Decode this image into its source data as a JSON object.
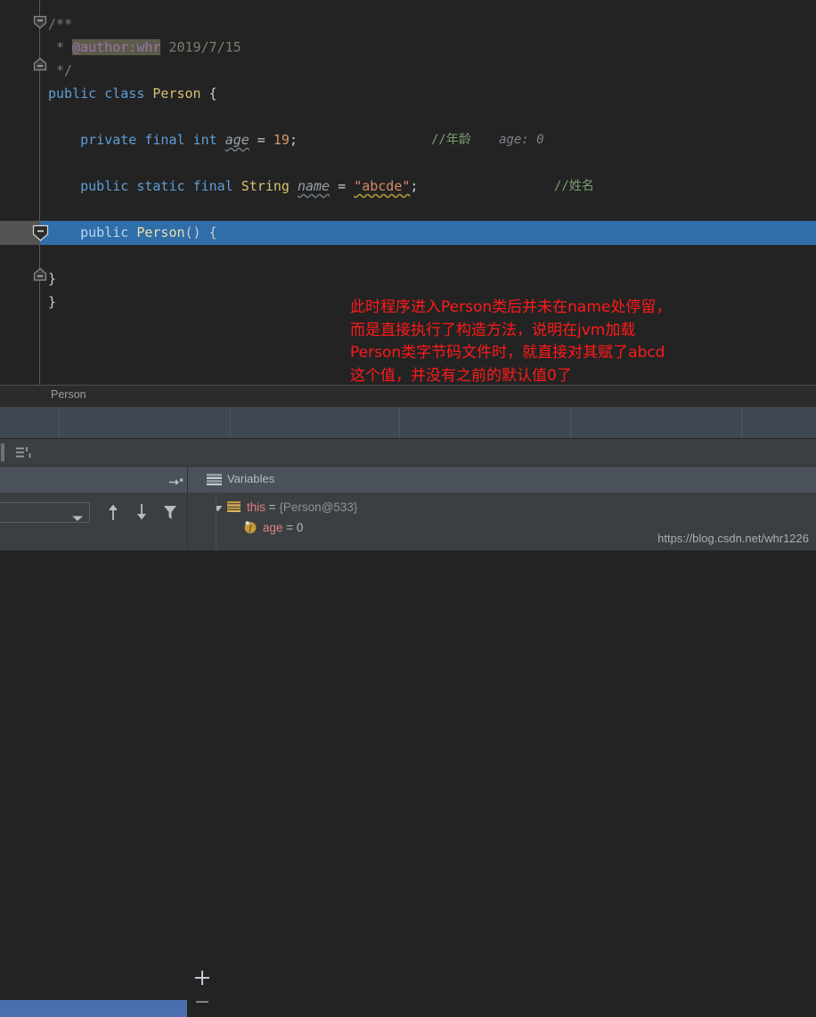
{
  "editor": {
    "lines": [
      {
        "indent": 0,
        "segments": [
          {
            "t": "/**",
            "c": "doc"
          }
        ]
      },
      {
        "indent": 0,
        "segments": [
          {
            "t": " * ",
            "c": "doc"
          },
          {
            "t": "@author:whr",
            "c": "doctag"
          },
          {
            "t": " 2019/7/15",
            "c": "doc"
          }
        ]
      },
      {
        "indent": 0,
        "segments": [
          {
            "t": " */",
            "c": "doc"
          }
        ]
      },
      {
        "indent": 0,
        "segments": [
          {
            "t": "public",
            "c": "kw"
          },
          {
            "t": " ",
            "c": "plain"
          },
          {
            "t": "class",
            "c": "kw"
          },
          {
            "t": " ",
            "c": "plain"
          },
          {
            "t": "Person",
            "c": "cls"
          },
          {
            "t": " {",
            "c": "plain"
          }
        ]
      },
      {
        "indent": 0,
        "segments": []
      },
      {
        "indent": 0,
        "segments": [
          {
            "t": "    ",
            "c": "plain"
          },
          {
            "t": "private",
            "c": "kw"
          },
          {
            "t": " ",
            "c": "plain"
          },
          {
            "t": "final",
            "c": "kw"
          },
          {
            "t": " ",
            "c": "plain"
          },
          {
            "t": "int",
            "c": "kw"
          },
          {
            "t": " ",
            "c": "plain"
          },
          {
            "t": "age",
            "c": "field-i wavy"
          },
          {
            "t": " = ",
            "c": "plain"
          },
          {
            "t": "19",
            "c": "num"
          },
          {
            "t": ";",
            "c": "plain"
          }
        ]
      },
      {
        "indent": 0,
        "segments": []
      },
      {
        "indent": 0,
        "segments": [
          {
            "t": "    ",
            "c": "plain"
          },
          {
            "t": "public",
            "c": "kw"
          },
          {
            "t": " ",
            "c": "plain"
          },
          {
            "t": "static",
            "c": "kw"
          },
          {
            "t": " ",
            "c": "plain"
          },
          {
            "t": "final",
            "c": "kw"
          },
          {
            "t": " ",
            "c": "plain"
          },
          {
            "t": "String",
            "c": "cls"
          },
          {
            "t": " ",
            "c": "plain"
          },
          {
            "t": "name",
            "c": "field-i wavy"
          },
          {
            "t": " = ",
            "c": "plain"
          },
          {
            "t": "\"abcde\"",
            "c": "str wavy-y"
          },
          {
            "t": ";",
            "c": "plain"
          }
        ]
      }
    ],
    "comment_age": "//年龄",
    "inline_hint_age": "age: 0",
    "comment_name": "//姓名",
    "exec_line_segments": [
      {
        "t": "    ",
        "c": "plain"
      },
      {
        "t": "public",
        "c": "kw"
      },
      {
        "t": " ",
        "c": "plain"
      },
      {
        "t": "Person",
        "c": "cls"
      },
      {
        "t": "() {",
        "c": "plain"
      }
    ],
    "close_brace_inner": "    }",
    "close_brace_outer": "}"
  },
  "annotation": {
    "text": "此时程序进入Person类后并未在name处停留，\n而是直接执行了构造方法，说明在jvm加载\nPerson类字节码文件时，就直接对其赋了abcd\n这个值，并没有之前的默认值0了",
    "color": "#ff1a1a"
  },
  "breadcrumb": {
    "label": "Person"
  },
  "debugger": {
    "variables_tab_label": "Variables",
    "tree": [
      {
        "name": "this",
        "eq": " = ",
        "value": "{Person@533}",
        "depth": 0,
        "expanded": true,
        "icon": "object-icon"
      },
      {
        "name": "age",
        "eq": " = ",
        "value": "0",
        "depth": 1,
        "expanded": false,
        "icon": "field-icon"
      }
    ],
    "buttons": {
      "up": "up-arrow",
      "down": "down-arrow",
      "filter": "filter-icon",
      "add": "+",
      "remove": "−",
      "combo_value": ""
    }
  },
  "watermark": {
    "url": "https://blog.csdn.net/whr1226"
  },
  "colors": {
    "editor_bg": "#232323",
    "exec_line": "#2f6ea8",
    "panel_bg": "#3c3f41",
    "panel_header": "#4a5159",
    "selection_blue": "#4b6eaf",
    "annotation_red": "#ff1a1a"
  }
}
